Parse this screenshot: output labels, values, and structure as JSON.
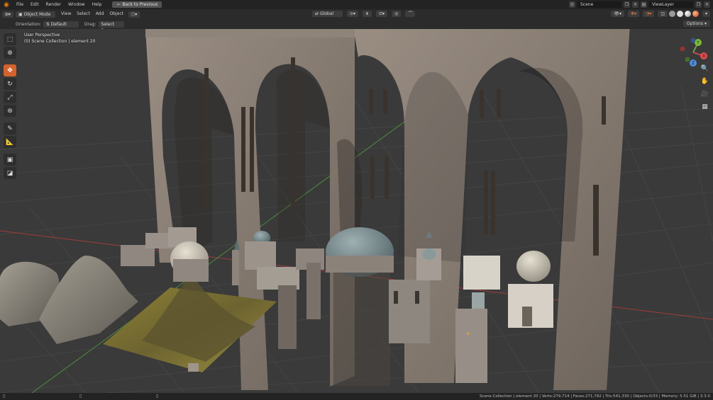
{
  "topbar": {
    "menus": [
      "File",
      "Edit",
      "Render",
      "Window",
      "Help"
    ],
    "back_button": "Back to Previous",
    "scene_name": "Scene",
    "view_layer": "ViewLayer"
  },
  "viewport_header": {
    "mode": "Object Mode",
    "menus": [
      "View",
      "Select",
      "Add",
      "Object"
    ],
    "transform_orientation": "Global"
  },
  "tool_settings": {
    "orientation_label": "Orientation:",
    "orientation_value": "Default",
    "drag_label": "Drag:",
    "drag_value": "Select Box",
    "options_label": "Options"
  },
  "viewport": {
    "perspective": "User Perspective",
    "collection_info": "(0) Scene Collection | element 20"
  },
  "toolbar": {
    "tools": [
      "select-box",
      "cursor",
      "move",
      "rotate",
      "scale",
      "transform",
      "annotate",
      "measure",
      "add-cube",
      "extrude"
    ],
    "active_tool": "move"
  },
  "gizmo": {
    "axes": [
      "X",
      "Y",
      "Z"
    ],
    "colors": {
      "x": "#e24c4c",
      "y": "#7dbb3c",
      "z": "#4f8fe0"
    }
  },
  "statusbar": {
    "info": "Scene Collection | element 20 | Verts:279,714 | Faces:271,792 | Tris:541,330 | Objects:0/33 | Memory: 5.51 GiB | 3.3.0"
  },
  "colors": {
    "accent": "#d4622d",
    "grid_x_axis": "#a23a3a",
    "grid_y_axis": "#4d8f3a"
  }
}
